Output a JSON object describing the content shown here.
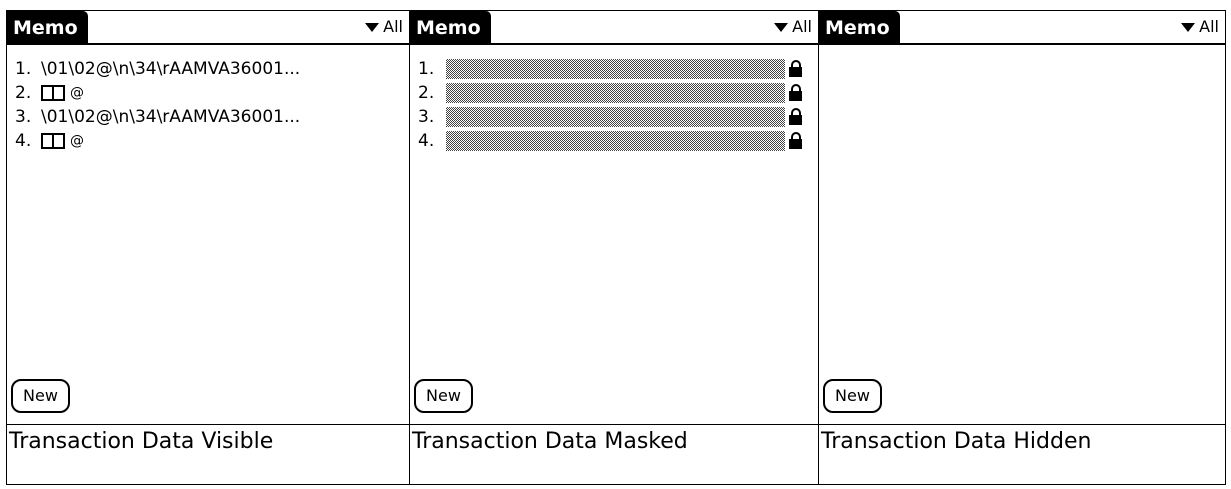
{
  "panels": [
    {
      "title": "Memo",
      "category": "All",
      "new_button": "New",
      "caption": "Transaction Data Visible",
      "items": [
        {
          "num": "1.",
          "text": "\\01\\02@\\n\\34\\rAAMVA36001..."
        },
        {
          "num": "2.",
          "glyph": "@"
        },
        {
          "num": "3.",
          "text": "\\01\\02@\\n\\34\\rAAMVA36001..."
        },
        {
          "num": "4.",
          "glyph": "@"
        }
      ]
    },
    {
      "title": "Memo",
      "category": "All",
      "new_button": "New",
      "caption": "Transaction Data Masked",
      "items": [
        {
          "num": "1."
        },
        {
          "num": "2."
        },
        {
          "num": "3."
        },
        {
          "num": "4."
        }
      ]
    },
    {
      "title": "Memo",
      "category": "All",
      "new_button": "New",
      "caption": "Transaction Data Hidden",
      "items": []
    }
  ]
}
